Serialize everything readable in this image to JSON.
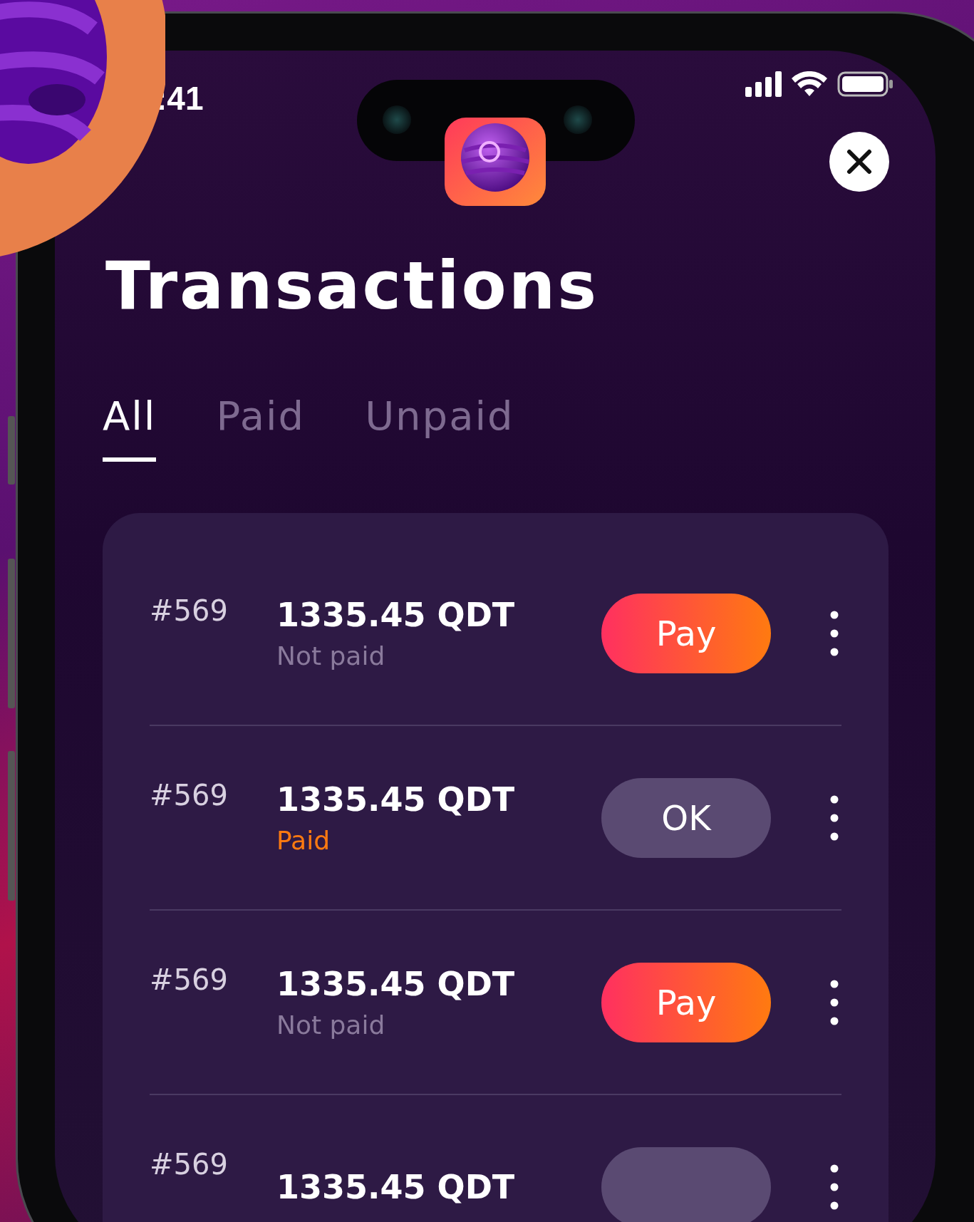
{
  "status_bar": {
    "time": ":41"
  },
  "title": "Transactions",
  "tabs": [
    {
      "label": "All",
      "selected": true
    },
    {
      "label": "Paid",
      "selected": false
    },
    {
      "label": "Unpaid",
      "selected": false
    }
  ],
  "transactions": [
    {
      "number": "#569",
      "amount": "1335.45 QDT",
      "status": "Not paid",
      "paid": false,
      "action": "Pay"
    },
    {
      "number": "#569",
      "amount": "1335.45 QDT",
      "status": "Paid",
      "paid": true,
      "action": "OK"
    },
    {
      "number": "#569",
      "amount": "1335.45 QDT",
      "status": "Not paid",
      "paid": false,
      "action": "Pay"
    },
    {
      "number": "#569",
      "amount": "1335.45 QDT",
      "paid": true
    }
  ]
}
